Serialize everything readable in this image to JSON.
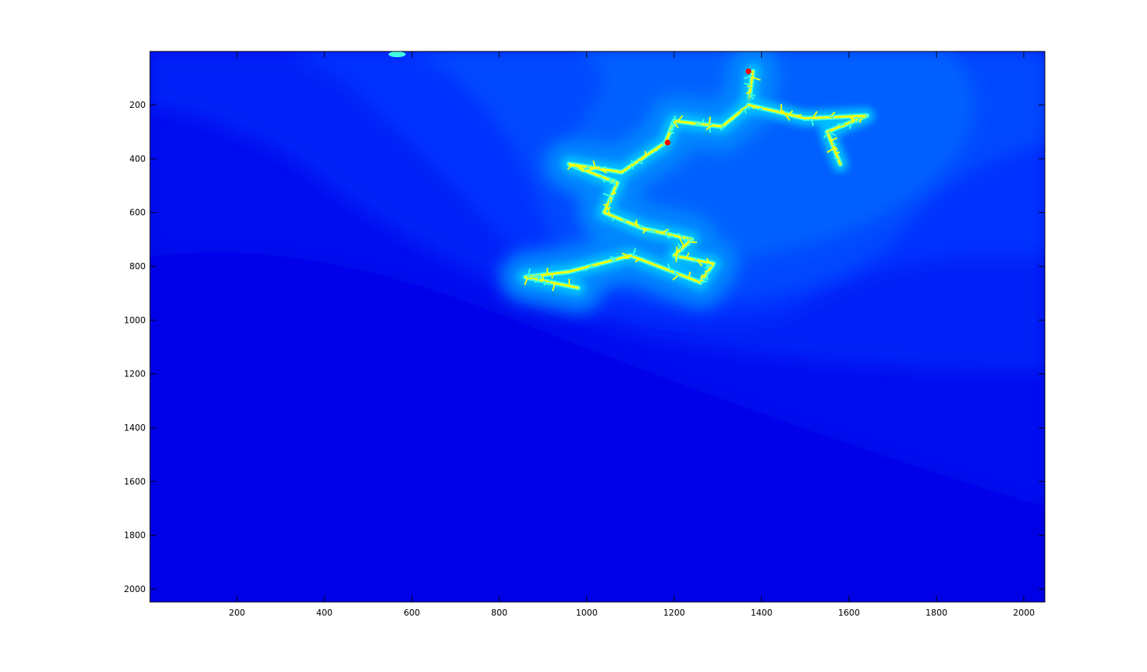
{
  "chart_data": {
    "type": "heatmap",
    "title": "",
    "xlabel": "",
    "ylabel": "",
    "xlim": [
      1,
      2048
    ],
    "ylim": [
      1,
      2048
    ],
    "y_direction": "reverse",
    "grid": false,
    "colormap": "jet",
    "x_ticks": [
      200,
      400,
      600,
      800,
      1000,
      1200,
      1400,
      1600,
      1800,
      2000
    ],
    "y_ticks": [
      200,
      400,
      600,
      800,
      1000,
      1200,
      1400,
      1600,
      1800,
      2000
    ],
    "x_tick_labels": [
      "200",
      "400",
      "600",
      "800",
      "1000",
      "1200",
      "1400",
      "1600",
      "1800",
      "2000"
    ],
    "y_tick_labels": [
      "200",
      "400",
      "600",
      "800",
      "1000",
      "1200",
      "1400",
      "1600",
      "1800",
      "2000"
    ],
    "fractal_path": [
      [
        1380,
        75
      ],
      [
        1370,
        200
      ],
      [
        1310,
        280
      ],
      [
        1200,
        260
      ],
      [
        1180,
        340
      ],
      [
        1080,
        450
      ],
      [
        960,
        420
      ],
      [
        1070,
        490
      ],
      [
        1040,
        600
      ],
      [
        1130,
        660
      ],
      [
        1240,
        700
      ],
      [
        1200,
        760
      ],
      [
        1290,
        790
      ],
      [
        1260,
        860
      ],
      [
        1100,
        760
      ],
      [
        960,
        820
      ],
      [
        860,
        840
      ],
      [
        980,
        880
      ]
    ],
    "fractal_branch": [
      [
        1370,
        200
      ],
      [
        1500,
        250
      ],
      [
        1640,
        240
      ],
      [
        1550,
        300
      ],
      [
        1580,
        420
      ]
    ],
    "fractal_hotspots": [
      [
        1370,
        75
      ],
      [
        1185,
        340
      ]
    ],
    "colors": {
      "frame": "#000000",
      "background": "#ffffff",
      "band_colors": [
        "#0000e6",
        "#0010f0",
        "#0022f8",
        "#0033ff",
        "#0048ff",
        "#0060ff",
        "#0088ff",
        "#00c0ff",
        "#40ffe0",
        "#ffff00",
        "#ff0000"
      ]
    }
  }
}
